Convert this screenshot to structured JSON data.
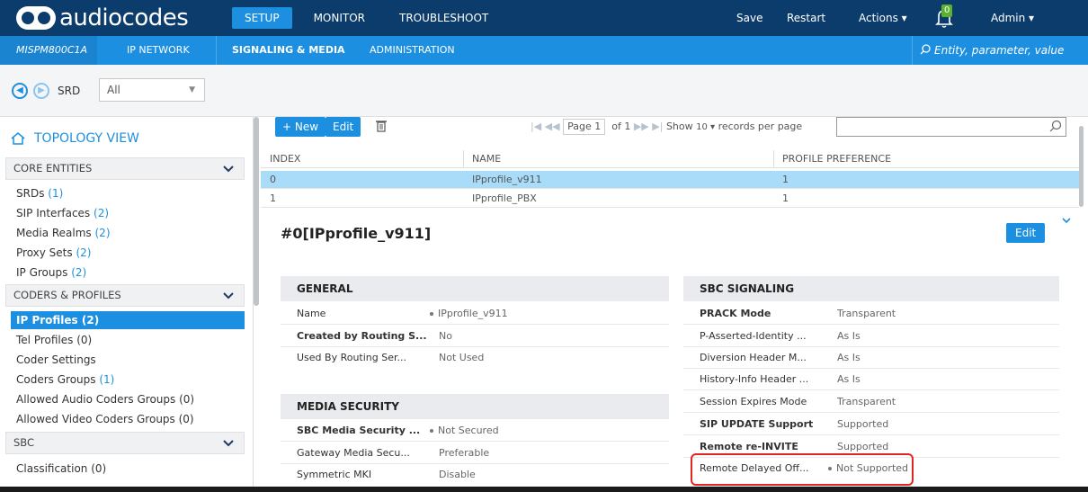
{
  "brand": {
    "logo_text": "audiocodes"
  },
  "topnav": [
    "SETUP",
    "MONITOR",
    "TROUBLESHOOT"
  ],
  "topright": {
    "save": "Save",
    "restart": "Restart",
    "actions": "Actions ▾",
    "notif_count": "0",
    "admin": "Admin ▾"
  },
  "subnav": {
    "device": "MISPM800C1A",
    "items": [
      "IP NETWORK",
      "SIGNALING & MEDIA",
      "ADMINISTRATION"
    ],
    "search_placeholder": "Entity, parameter, value"
  },
  "srd": {
    "label": "SRD",
    "value": "All"
  },
  "sidebar": {
    "title": "TOPOLOGY VIEW",
    "sections": [
      {
        "label": "CORE ENTITIES",
        "items": [
          {
            "label": "SRDs",
            "count": "(1)"
          },
          {
            "label": "SIP Interfaces",
            "count": "(2)"
          },
          {
            "label": "Media Realms",
            "count": "(2)"
          },
          {
            "label": "Proxy Sets",
            "count": "(2)"
          },
          {
            "label": "IP Groups",
            "count": "(2)"
          }
        ]
      },
      {
        "label": "CODERS & PROFILES",
        "items": [
          {
            "label": "IP Profiles (2)",
            "count": ""
          },
          {
            "label": "Tel Profiles (0)",
            "count": ""
          },
          {
            "label": "Coder Settings",
            "count": ""
          },
          {
            "label": "Coders Groups",
            "count": "(1)"
          },
          {
            "label": "Allowed Audio Coders Groups (0)",
            "count": ""
          },
          {
            "label": "Allowed Video Coders Groups (0)",
            "count": ""
          }
        ]
      },
      {
        "label": "SBC",
        "items": [
          {
            "label": "Classification (0)",
            "count": ""
          }
        ]
      }
    ]
  },
  "toolbar": {
    "new": "+ New",
    "edit": "Edit",
    "page_label": "Page",
    "page_value": "1",
    "of_label": "of 1",
    "show_label": "Show",
    "records_value": "10 ▾",
    "records_label": "records per page"
  },
  "table": {
    "headers": [
      "INDEX",
      "NAME",
      "PROFILE PREFERENCE"
    ],
    "rows": [
      [
        "0",
        "IPprofile_v911",
        "1"
      ],
      [
        "1",
        "IPprofile_PBX",
        "1"
      ]
    ]
  },
  "detail": {
    "title": "#0[IPprofile_v911]",
    "edit": "Edit",
    "general": {
      "title": "GENERAL",
      "rows": [
        {
          "label": "Name",
          "value": "IPprofile_v911"
        },
        {
          "label": "Created by Routing S...",
          "value": "No"
        },
        {
          "label": "Used By Routing Ser...",
          "value": "Not Used"
        }
      ]
    },
    "media_security": {
      "title": "MEDIA SECURITY",
      "rows": [
        {
          "label": "SBC Media Security ...",
          "value": "Not Secured"
        },
        {
          "label": "Gateway Media Secu...",
          "value": "Preferable"
        },
        {
          "label": "Symmetric MKI",
          "value": "Disable"
        }
      ]
    },
    "sbc_signaling": {
      "title": "SBC SIGNALING",
      "rows": [
        {
          "label": "PRACK Mode",
          "value": "Transparent"
        },
        {
          "label": "P-Asserted-Identity ...",
          "value": "As Is"
        },
        {
          "label": "Diversion Header M...",
          "value": "As Is"
        },
        {
          "label": "History-Info Header ...",
          "value": "As Is"
        },
        {
          "label": "Session Expires Mode",
          "value": "Transparent"
        },
        {
          "label": "SIP UPDATE Support",
          "value": "Supported"
        },
        {
          "label": "Remote re-INVITE",
          "value": "Supported"
        },
        {
          "label": "Remote Delayed Off...",
          "value": "Not Supported"
        }
      ]
    }
  },
  "colors": {
    "topbar": "#0c3c6b",
    "accent": "#1d8fe0",
    "selected_row": "#a9dcf8",
    "highlight": "#e0261e"
  }
}
